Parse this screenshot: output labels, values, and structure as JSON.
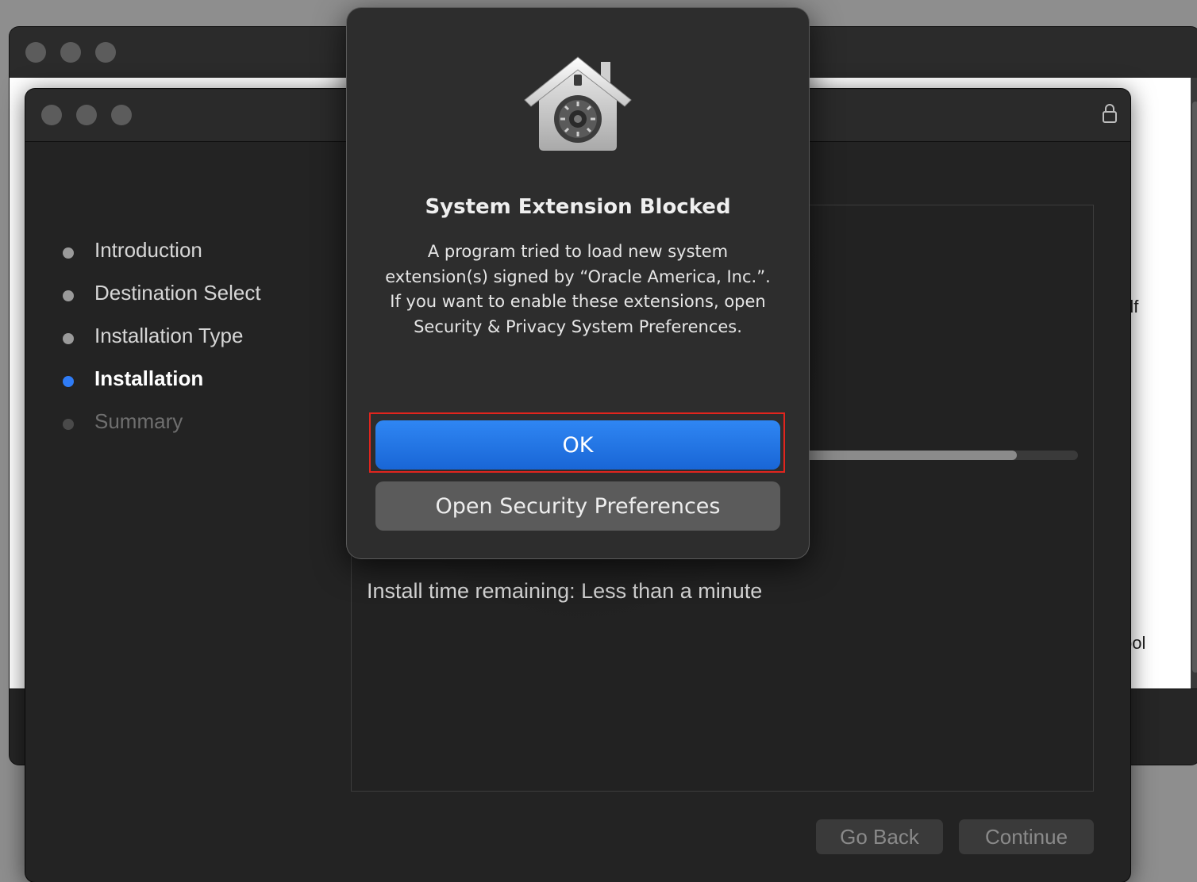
{
  "background_window": {
    "content_snippets": [
      "df",
      "ool"
    ]
  },
  "installer": {
    "steps": [
      {
        "label": "Introduction",
        "state": "done"
      },
      {
        "label": "Destination Select",
        "state": "done"
      },
      {
        "label": "Installation Type",
        "state": "done"
      },
      {
        "label": "Installation",
        "state": "current"
      },
      {
        "label": "Summary",
        "state": "future"
      }
    ],
    "progress_fraction": 0.9,
    "time_remaining": "Install time remaining: Less than a minute",
    "buttons": {
      "go_back": "Go Back",
      "continue": "Continue"
    },
    "lock_icon": "lock-icon"
  },
  "alert": {
    "icon": "security-house-icon",
    "title": "System Extension Blocked",
    "message": "A program tried to load new system extension(s) signed by “Oracle America, Inc.”. If you want to enable these extensions, open Security & Privacy System Preferences.",
    "ok_label": "OK",
    "open_security_label": "Open Security Preferences",
    "highlight_color": "#e0251e"
  },
  "colors": {
    "accent": "#2f7cf6",
    "ok_button": "#1f73e6"
  }
}
